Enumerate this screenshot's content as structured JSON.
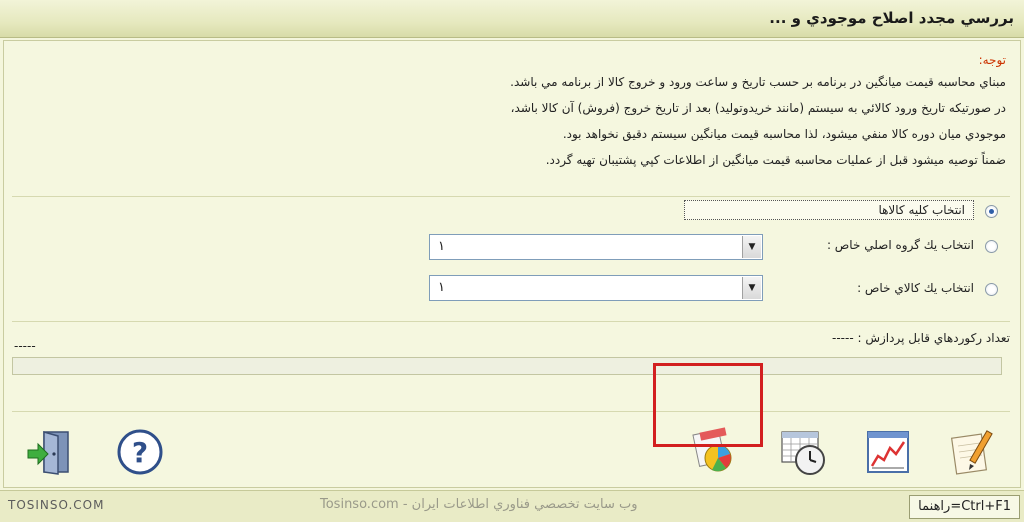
{
  "window": {
    "title": "بررسي مجدد اصلاح موجودي و ..."
  },
  "notice": {
    "title": "توجه:",
    "lines": [
      "مبناي محاسبه قيمت ميانگين در برنامه بر حسب تاريخ و ساعت ورود و خروج كالا از برنامه مي باشد.",
      "در صورتيكه تاريخ ورود كالائي به سيستم (مانند خريدوتوليد) بعد از تاريخ خروج (فروش) آن كالا باشد،",
      "موجودي ميان دوره كالا منفي ميشود، لذا محاسبه قيمت ميانگين سيستم دقيق نخواهد بود.",
      "ضمناً توصيه ميشود قبل از عمليات محاسبه قيمت ميانگين از اطلاعات كپي پشتيبان تهيه گردد."
    ]
  },
  "options": {
    "all_goods": "انتخاب كليه كالاها",
    "main_group": "انتخاب يك گروه اصلي خاص :",
    "single_good": "انتخاب يك كالاي خاص :",
    "selected": "all_goods"
  },
  "combos": {
    "main_group_value": "١",
    "single_good_value": "١"
  },
  "records": {
    "label": "تعداد ركوردهاي قابل پردازش : -----",
    "left_value": "-----",
    "progress": 0
  },
  "toolbar": {
    "items": [
      {
        "name": "edit",
        "icon": "notepad-pencil-icon"
      },
      {
        "name": "report",
        "icon": "chart-document-icon"
      },
      {
        "name": "calendar",
        "icon": "calendar-clock-icon"
      },
      {
        "name": "calculate",
        "icon": "pie-chart-calculator-icon",
        "highlighted": true
      },
      {
        "name": "help",
        "icon": "question-icon"
      },
      {
        "name": "exit",
        "icon": "exit-door-icon"
      }
    ]
  },
  "status": {
    "help_hint": "راهنما=Ctrl+F1",
    "watermark_left": "TOSINSO.COM",
    "watermark_center": "وب سايت تخصصي فناوري اطلاعات ايران - Tosinso.com"
  },
  "colors": {
    "background": "#f4f6dc",
    "notice_title": "#cc3300",
    "highlight_box": "#d21f1f"
  }
}
